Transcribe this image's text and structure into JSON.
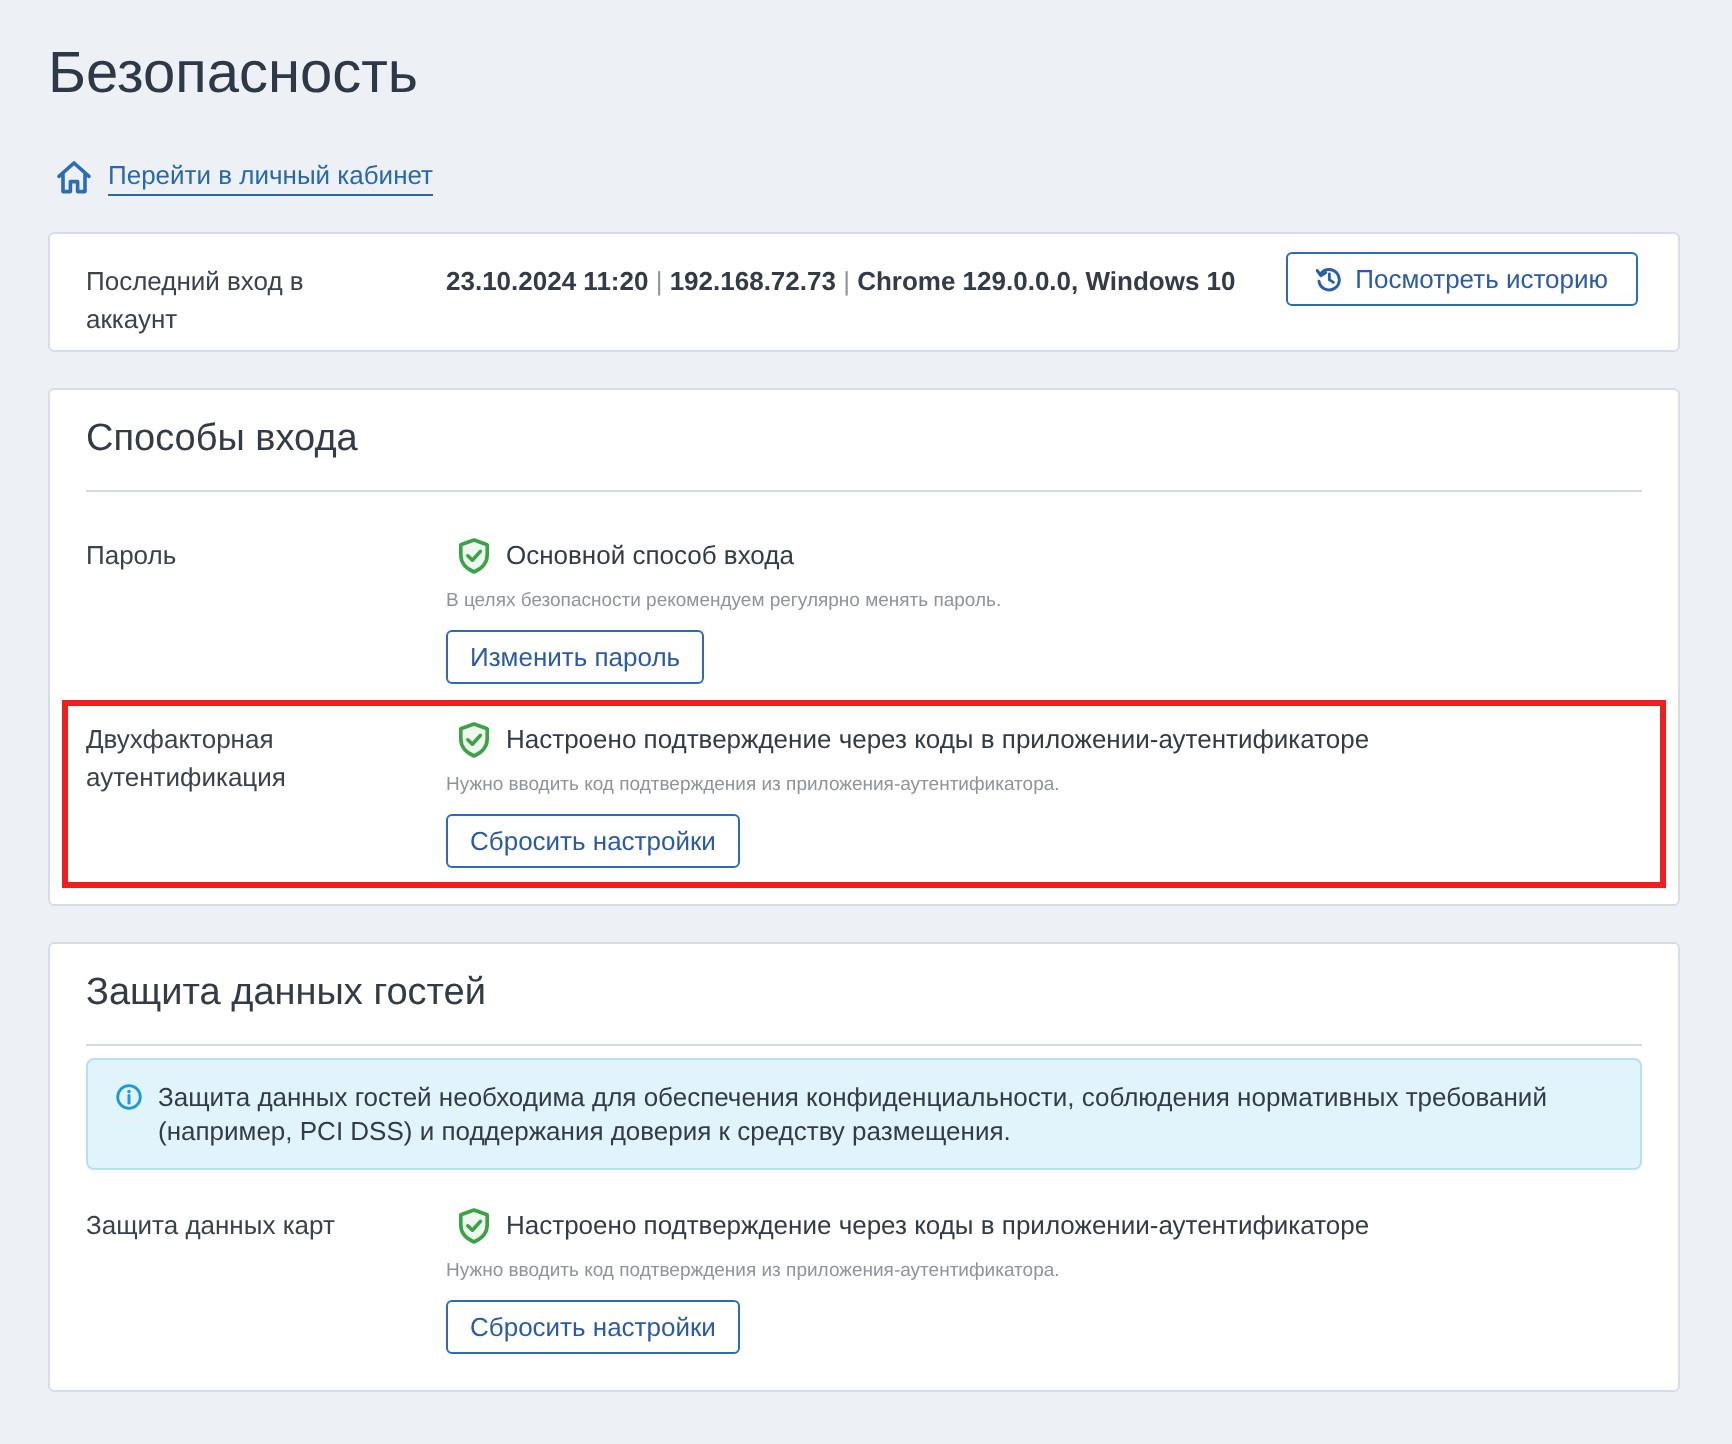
{
  "page": {
    "title": "Безопасность"
  },
  "back_link": {
    "label": "Перейти в личный кабинет"
  },
  "last_login": {
    "label": "Последний вход в аккаунт",
    "details": "**23.10.2024 11:20** | **192.168.72.73** | **Chrome 129.0.0.0, Windows 10**",
    "button": "Посмотреть историю"
  },
  "sections": [
    {
      "title": "Способы входа",
      "rows": [
        {
          "label": "Пароль",
          "status": "Основной способ входа",
          "hint": "В целях безопасности рекомендуем регулярно менять пароль.",
          "button": "Изменить пароль",
          "highlighted": false
        },
        {
          "label": "Двухфакторная аутентификация",
          "status": "Настроено подтверждение через коды в приложении-аутентификаторе",
          "hint": "Нужно вводить код подтверждения из приложения-аутентификатора.",
          "button": "Сбросить настройки",
          "highlighted": true
        }
      ]
    },
    {
      "title": "Защита данных гостей",
      "info": "Защита данных гостей необходима для обеспечения конфиденциальности, соблюдения нормативных требований (например, PCI DSS) и поддержания доверия к средству размещения.",
      "rows": [
        {
          "label": "Защита данных карт",
          "status": "Настроено подтверждение через коды в приложении-аутентификаторе",
          "hint": "Нужно вводить код подтверждения из приложения-аутентификатора.",
          "button": "Сбросить настройки",
          "highlighted": false
        }
      ]
    }
  ]
}
